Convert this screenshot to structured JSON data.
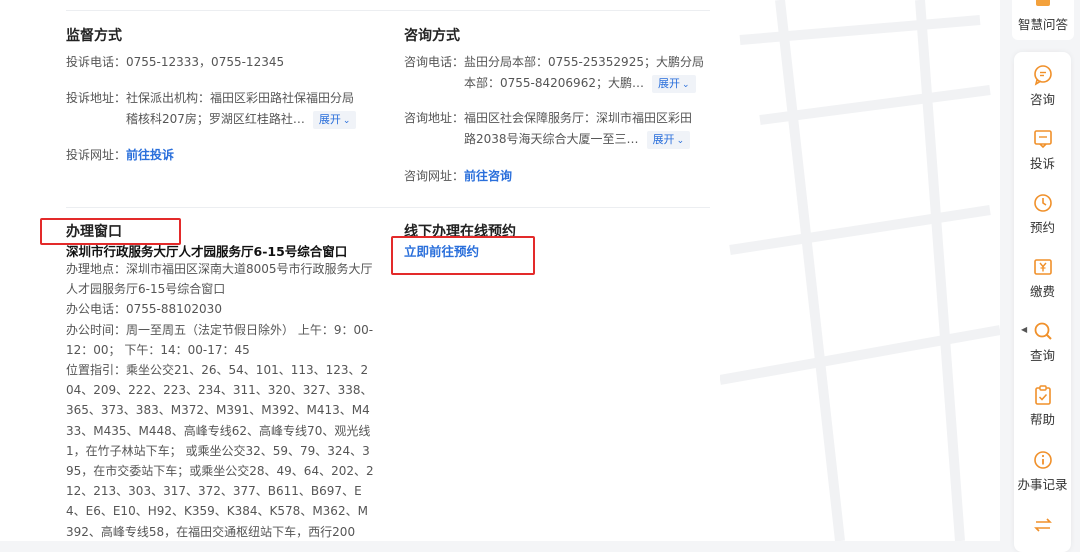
{
  "supervision": {
    "title": "监督方式",
    "phone_label": "投诉电话：",
    "phone_value": "0755-12333，0755-12345",
    "address_label": "投诉地址：",
    "address_line1": "社保派出机构：福田区彩田路社保福田分局",
    "address_line2": "稽核科207房；罗湖区红桂路社…",
    "expand_label": "展开",
    "url_label": "投诉网址：",
    "url_link": "前往投诉"
  },
  "consult": {
    "title": "咨询方式",
    "phone_label": "咨询电话：",
    "phone_line1": "盐田分局本部：0755-25352925；大鹏分局",
    "phone_line2": "本部：0755-84206962；大鹏…",
    "expand_label": "展开",
    "address_label": "咨询地址：",
    "address_line1": "福田区社会保障服务厅：深圳市福田区彩田",
    "address_line2": "路2038号海天综合大厦一至三…",
    "url_label": "咨询网址：",
    "url_link": "前往咨询"
  },
  "window": {
    "title": "办理窗口",
    "name": "深圳市行政服务大厅人才园服务厅6-15号综合窗口",
    "location": "办理地点：深圳市福田区深南大道8005号市行政服务大厅人才园服务厅6-15号综合窗口",
    "phone": "办公电话：0755-88102030",
    "hours": "办公时间：周一至周五（法定节假日除外） 上午：9：00-12：00； 下午：14：00-17：45",
    "directions": "位置指引：乘坐公交21、26、54、101、113、123、204、209、222、223、234、311、320、327、338、365、373、383、M372、M391、M392、M413、M433、M435、M448、高峰专线62、高峰专线70、观光线1，在竹子林站下车； 或乘坐公交32、59、79、324、395，在市交委站下车；或乘坐公交28、49、64、202、212、213、303、317、372、377、B611、B697、E4、E6、E10、H92、K359、K384、K578、M362、M392、高峰专线58，在福田交通枢纽站下车，西行200"
  },
  "booking": {
    "title": "线下办理在线预约",
    "link": "立即前往预约"
  },
  "sidebar": {
    "top_label": "智慧问答",
    "items": [
      {
        "label": "咨询",
        "icon": "chat-bubble-icon"
      },
      {
        "label": "投诉",
        "icon": "complaint-icon"
      },
      {
        "label": "预约",
        "icon": "clock-icon"
      },
      {
        "label": "缴费",
        "icon": "yuan-icon"
      },
      {
        "label": "查询",
        "icon": "search-icon"
      },
      {
        "label": "帮助",
        "icon": "clipboard-icon"
      },
      {
        "label": "办事记录",
        "icon": "info-icon"
      },
      {
        "label": "",
        "icon": "swap-icon"
      }
    ]
  },
  "colors": {
    "accent": "#f3a13c",
    "link": "#2a6fdb",
    "highlight_box": "#e32a2a"
  }
}
